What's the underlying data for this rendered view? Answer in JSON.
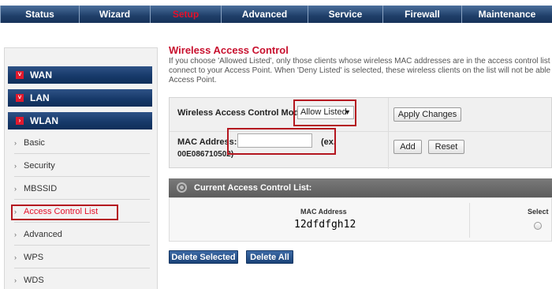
{
  "nav": {
    "tabs": [
      {
        "label": "Status"
      },
      {
        "label": "Wizard"
      },
      {
        "label": "Setup"
      },
      {
        "label": "Advanced"
      },
      {
        "label": "Service"
      },
      {
        "label": "Firewall"
      },
      {
        "label": "Maintenance"
      }
    ],
    "active_tab": "Setup"
  },
  "sidebar": {
    "sections": [
      {
        "label": "WAN",
        "state": "collapsed"
      },
      {
        "label": "LAN",
        "state": "collapsed"
      },
      {
        "label": "WLAN",
        "state": "expanded"
      }
    ],
    "items": [
      {
        "label": "Basic"
      },
      {
        "label": "Security"
      },
      {
        "label": "MBSSID"
      },
      {
        "label": "Access Control List"
      },
      {
        "label": "Advanced"
      },
      {
        "label": "WPS"
      },
      {
        "label": "WDS"
      }
    ],
    "current_item": "Access Control List"
  },
  "page": {
    "title": "Wireless Access Control",
    "description_lines": [
      "If you choose 'Allowed Listed', only those clients whose wireless MAC addresses are in the access control list will b",
      "connect to your Access Point. When 'Deny Listed' is selected, these wireless clients on the list will not be able to co",
      "Access Point."
    ]
  },
  "form": {
    "mode_label": "Wireless Access Control Mode:",
    "mode_value": "Allow Listed",
    "apply_label": "Apply Changes",
    "mac_label": "MAC Address:",
    "mac_value": "",
    "mac_example_1": "(ex.",
    "mac_example_2": "00E086710502)",
    "add_label": "Add",
    "reset_label": "Reset"
  },
  "list": {
    "header": "Current Access Control List:",
    "columns": [
      "MAC Address",
      "Select"
    ],
    "rows": [
      {
        "mac": "12dfdfgh12",
        "selected": false
      }
    ],
    "delete_selected_label": "Delete Selected",
    "delete_all_label": "Delete All"
  },
  "colors": {
    "accent_red": "#c8102e",
    "nav_blue": "#1f3f69",
    "highlight_box": "#b4161f"
  },
  "icons": {
    "section_expand": "expand-chevron-icon",
    "subitem": "arrow-right-icon",
    "list_header": "gear-icon",
    "select_caret": "caret-down-icon"
  }
}
